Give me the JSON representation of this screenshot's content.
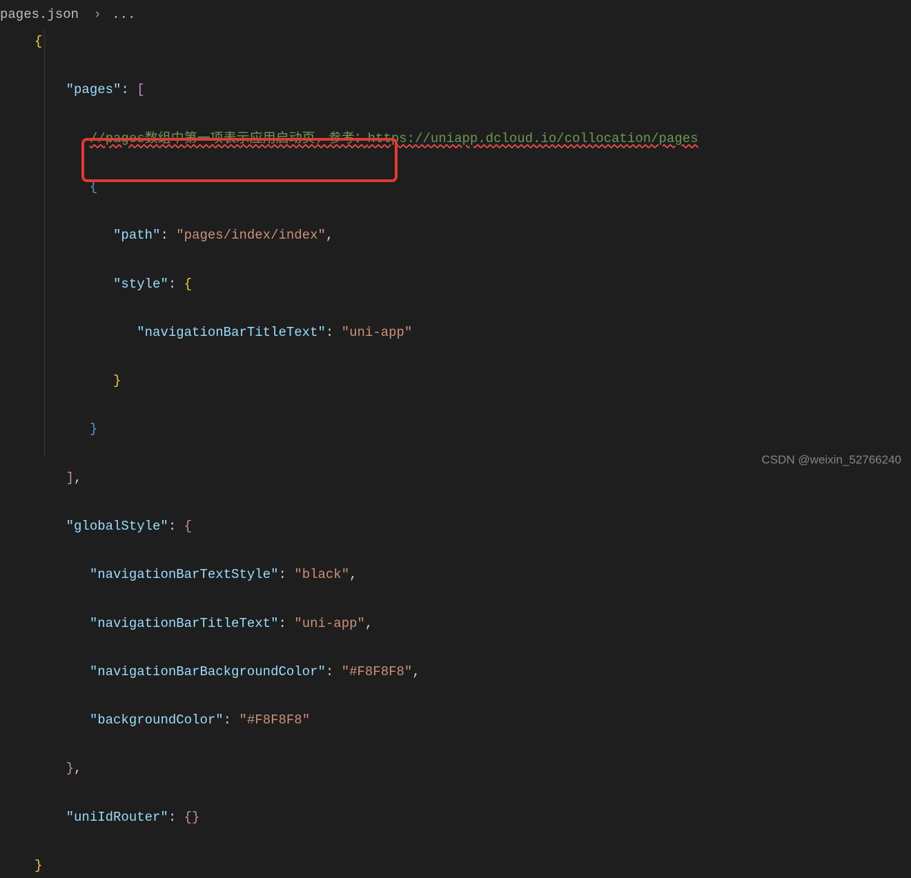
{
  "breadcrumb": {
    "file": "pages.json",
    "sep": "›",
    "rest": "..."
  },
  "code": {
    "openBrace": "{",
    "keys": {
      "pages": "\"pages\"",
      "path": "\"path\"",
      "style": "\"style\"",
      "navTitle": "\"navigationBarTitleText\"",
      "globalStyle": "\"globalStyle\"",
      "navTextStyle": "\"navigationBarTextStyle\"",
      "navBg": "\"navigationBarBackgroundColor\"",
      "bgColor": "\"backgroundColor\"",
      "uniIdRouter": "\"uniIdRouter\""
    },
    "vals": {
      "pathVal": "\"pages/index/index\"",
      "uniapp": "\"uni-app\"",
      "black": "\"black\"",
      "f8": "\"#F8F8F8\""
    },
    "commentPrefix": "//pages数组中第一项表示应用启动页，参考：",
    "commentLink": "https://uniapp.dcloud.io/collocation/pages",
    "colon": ":",
    "comma": ",",
    "lbracket": "[",
    "rbracket": "]",
    "lbrace": "{",
    "rbrace": "}",
    "emptyObj": "{}",
    "closeBrace": "}"
  },
  "watermark": "CSDN @weixin_52766240"
}
